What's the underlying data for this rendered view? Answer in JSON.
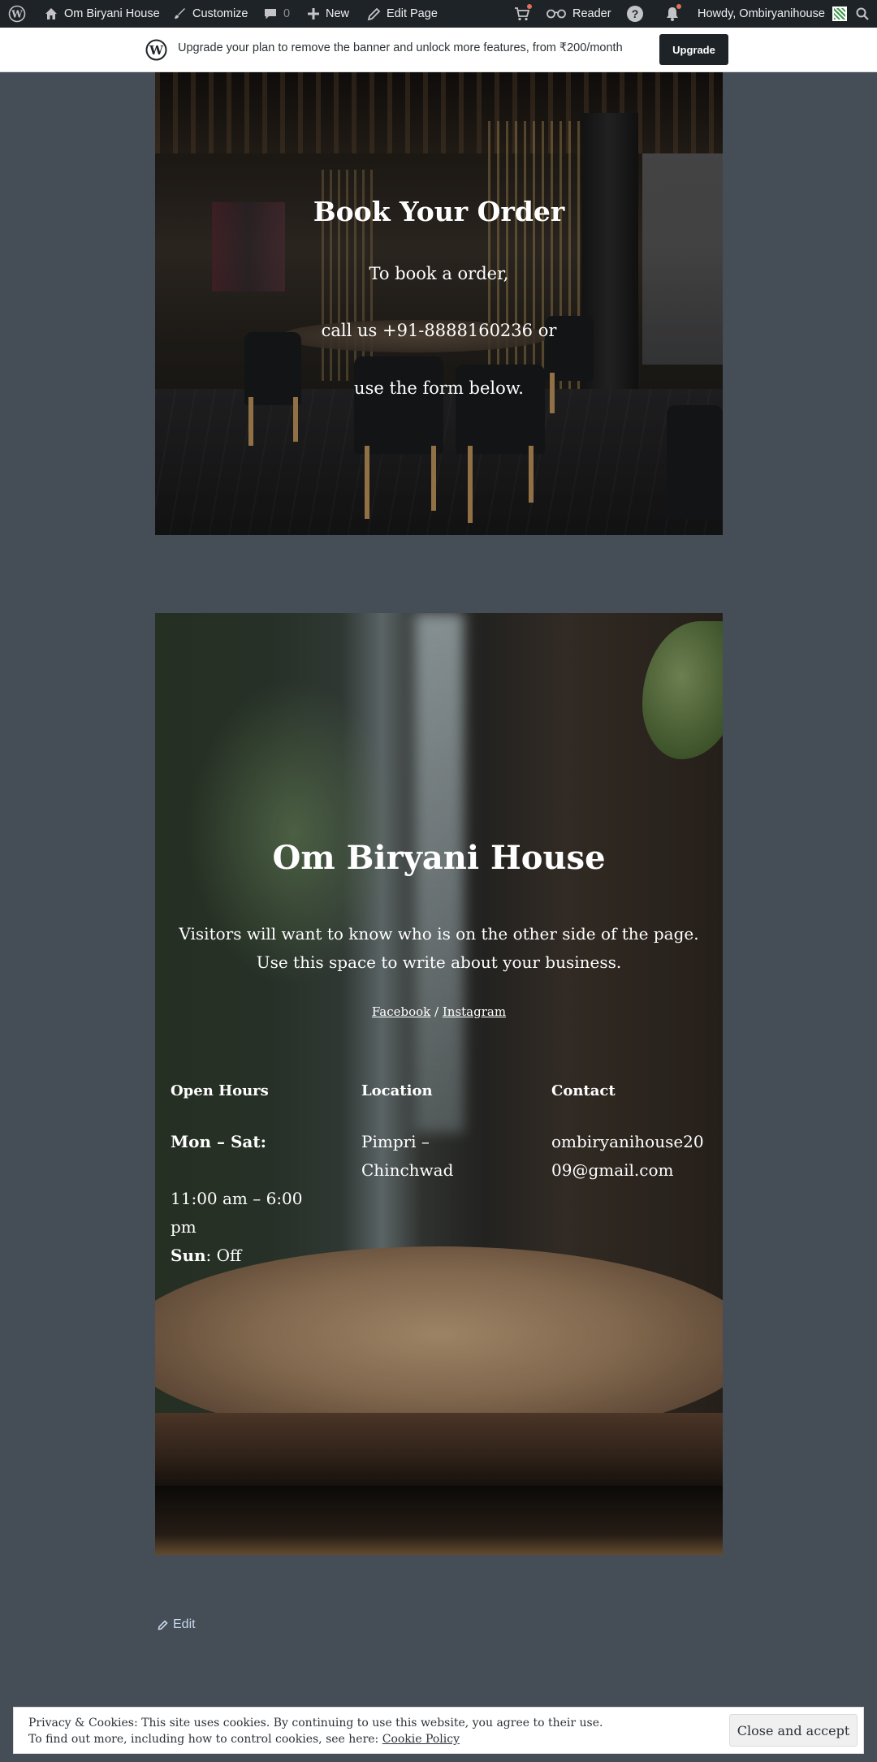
{
  "admin_bar": {
    "site_name": "Om Biryani House",
    "customize": "Customize",
    "comments_count": "0",
    "new_label": "New",
    "edit_page": "Edit Page",
    "reader": "Reader",
    "greeting": "Howdy, Ombiryanihouse"
  },
  "banner": {
    "text": "Upgrade your plan to remove the banner and unlock more features, from ₹200/month",
    "button": "Upgrade"
  },
  "book": {
    "title": "Book Your Order",
    "lines": [
      "To book a order,",
      "call us +91-8888160236 or",
      "use the form below."
    ]
  },
  "about": {
    "title": "Om Biryani House",
    "description": "Visitors will want to know who is on the other side of the page. Use this space to write about your business.",
    "social": {
      "facebook": "Facebook",
      "separator": " / ",
      "instagram": "Instagram"
    },
    "columns": {
      "hours": {
        "heading": "Open Hours",
        "line1": "Mon – Sat:",
        "line2": "11:00 am – 6:00 pm",
        "line3_bold": "Sun",
        "line3_rest": ": Off"
      },
      "location": {
        "heading": "Location",
        "body": "Pimpri – Chinchwad"
      },
      "contact": {
        "heading": "Contact",
        "body": "ombiryanihouse2009@gmail.com"
      }
    }
  },
  "edit": {
    "label": "Edit"
  },
  "cookie": {
    "line1": "Privacy & Cookies: This site uses cookies. By continuing to use this website, you agree to their use.",
    "line2": "To find out more, including how to control cookies, see here: ",
    "link": "Cookie Policy",
    "button": "Close and accept"
  },
  "colors": {
    "admin_bar_bg": "#1d2327",
    "page_bg": "#454e57",
    "notification_dot": "#e26f56",
    "upgrade_button_bg": "#1d2327"
  }
}
